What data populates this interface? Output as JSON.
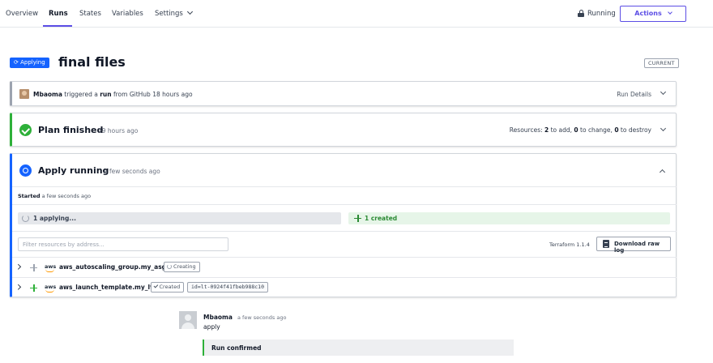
{
  "nav": {
    "tabs": [
      {
        "label": "Overview"
      },
      {
        "label": "Runs"
      },
      {
        "label": "States"
      },
      {
        "label": "Variables"
      },
      {
        "label": "Settings"
      }
    ],
    "active_tab": "Runs",
    "lock_status": "Running",
    "actions_label": "Actions"
  },
  "header": {
    "status_chip": "Applying",
    "title": "final files",
    "current_badge": "CURRENT"
  },
  "trigger": {
    "user": "Mbaoma",
    "text_a": " triggered a ",
    "run_word": "run",
    "text_b": " from GitHub 18 hours ago",
    "details_label": "Run Details"
  },
  "plan": {
    "title": "Plan finished",
    "time": "19 hours ago",
    "resources_prefix": "Resources: ",
    "to_add": "2",
    "add_text": " to add, ",
    "to_change": "0",
    "change_text": " to change, ",
    "to_destroy": "0",
    "destroy_text": " to destroy"
  },
  "apply": {
    "title": "Apply running",
    "time": "a few seconds ago",
    "started_label": "Started",
    "started_time": " a few seconds ago",
    "applying_text": "1 applying...",
    "created_text": "1 created",
    "filter_placeholder": "Filter resources by address...",
    "terraform_version": "Terraform 1.1.4",
    "download_label": "Download raw log",
    "resources": [
      {
        "aws": "aws",
        "name": "aws_autoscaling_group.my_asg",
        "status": "Creating"
      },
      {
        "aws": "aws",
        "name": "aws_launch_template.my_lt",
        "status": "Created",
        "id": "id=lt-0924f41fbeb988c10"
      }
    ]
  },
  "comment": {
    "author": "Mbaoma",
    "time": "a few seconds ago",
    "body": "apply",
    "confirm": "Run confirmed"
  },
  "colors": {
    "brand": "#5c4ee5",
    "running_blue": "#1563ff",
    "success_green": "#2eb039",
    "neutral_gray": "#9ca3af"
  }
}
